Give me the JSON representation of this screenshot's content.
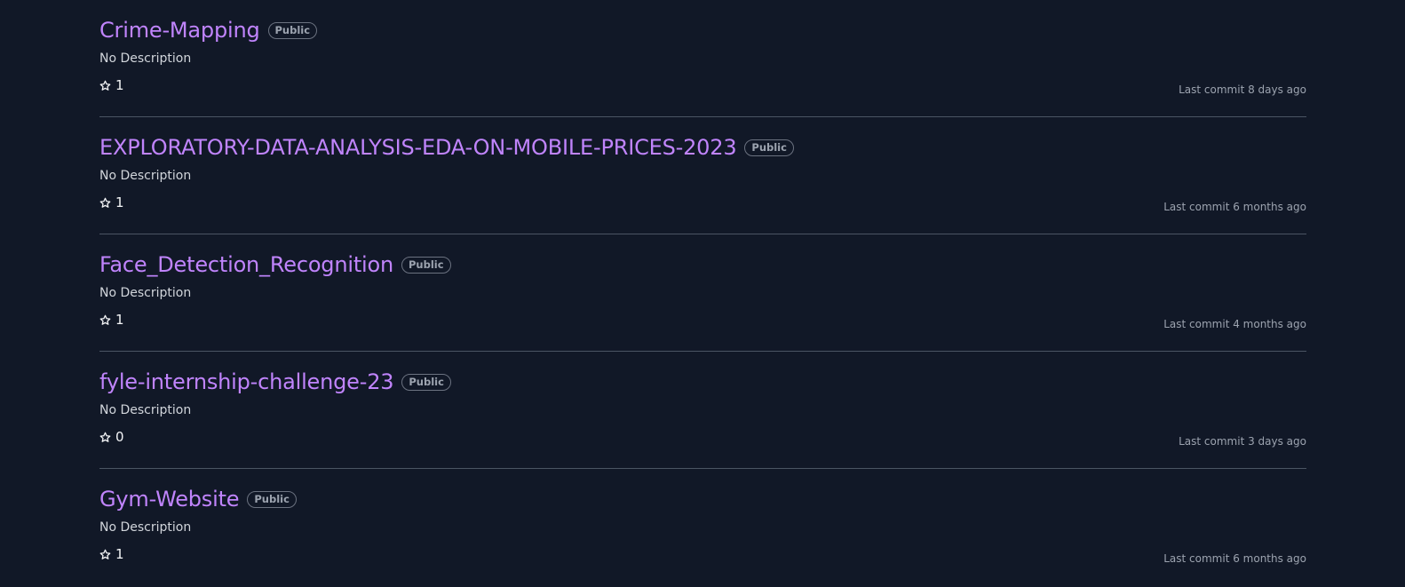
{
  "repos": [
    {
      "name": "Crime-Mapping",
      "visibility": "Public",
      "description": "No Description",
      "stars": "1",
      "last_commit": "Last commit 8 days ago"
    },
    {
      "name": "EXPLORATORY-DATA-ANALYSIS-EDA-ON-MOBILE-PRICES-2023",
      "visibility": "Public",
      "description": "No Description",
      "stars": "1",
      "last_commit": "Last commit 6 months ago"
    },
    {
      "name": "Face_Detection_Recognition",
      "visibility": "Public",
      "description": "No Description",
      "stars": "1",
      "last_commit": "Last commit 4 months ago"
    },
    {
      "name": "fyle-internship-challenge-23",
      "visibility": "Public",
      "description": "No Description",
      "stars": "0",
      "last_commit": "Last commit 3 days ago"
    },
    {
      "name": "Gym-Website",
      "visibility": "Public",
      "description": "No Description",
      "stars": "1",
      "last_commit": "Last commit 6 months ago"
    }
  ],
  "colors": {
    "background": "#111827",
    "repo_link": "#c084fc",
    "divider": "#4b5563",
    "muted": "#9ca3af"
  },
  "icons": {
    "star": "star-icon"
  }
}
